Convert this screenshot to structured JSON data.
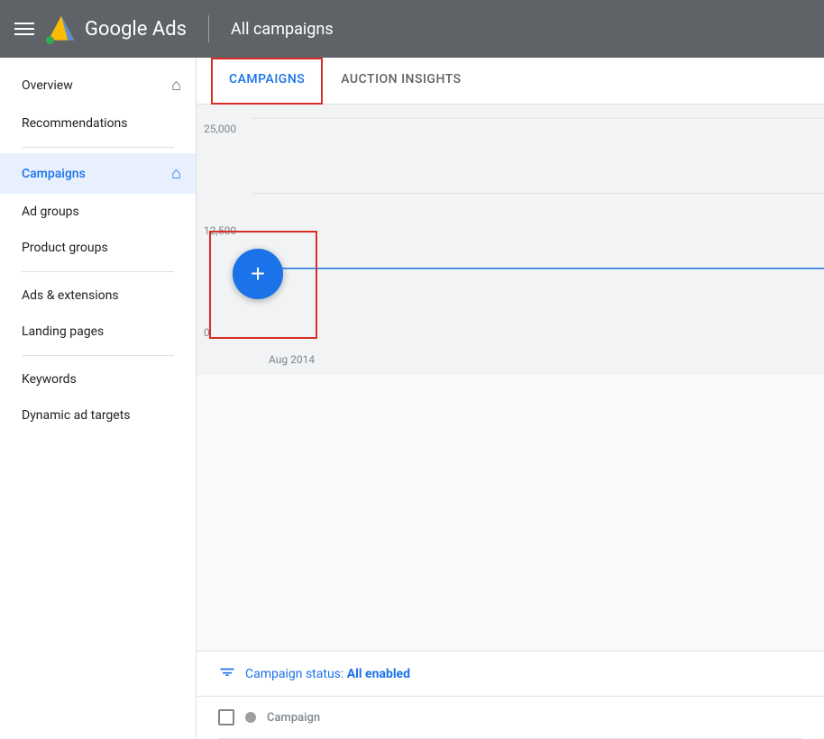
{
  "header": {
    "menu_label": "menu",
    "app_name": "Google Ads",
    "divider": "|",
    "page_title": "All campaigns"
  },
  "sidebar": {
    "items": [
      {
        "id": "overview",
        "label": "Overview",
        "has_home": true,
        "active": false
      },
      {
        "id": "recommendations",
        "label": "Recommendations",
        "has_home": false,
        "active": false
      },
      {
        "id": "campaigns",
        "label": "Campaigns",
        "has_home": true,
        "active": true
      },
      {
        "id": "ad-groups",
        "label": "Ad groups",
        "has_home": false,
        "active": false
      },
      {
        "id": "product-groups",
        "label": "Product groups",
        "has_home": false,
        "active": false
      },
      {
        "id": "ads-extensions",
        "label": "Ads & extensions",
        "has_home": false,
        "active": false
      },
      {
        "id": "landing-pages",
        "label": "Landing pages",
        "has_home": false,
        "active": false
      },
      {
        "id": "keywords",
        "label": "Keywords",
        "has_home": false,
        "active": false
      },
      {
        "id": "dynamic-ad-targets",
        "label": "Dynamic ad targets",
        "has_home": false,
        "active": false
      }
    ]
  },
  "tabs": [
    {
      "id": "campaigns",
      "label": "CAMPAIGNS",
      "active": true
    },
    {
      "id": "auction-insights",
      "label": "AUCTION INSIGHTS",
      "active": false
    }
  ],
  "chart": {
    "y_labels": [
      "25,000",
      "12,500",
      "0"
    ],
    "x_label": "Aug 2014"
  },
  "add_button": {
    "label": "+"
  },
  "filter": {
    "text": "Campaign status: ",
    "value": "All enabled"
  },
  "table": {
    "columns": [
      {
        "id": "checkbox",
        "label": ""
      },
      {
        "id": "status",
        "label": ""
      },
      {
        "id": "campaign",
        "label": "Campaign"
      }
    ]
  }
}
